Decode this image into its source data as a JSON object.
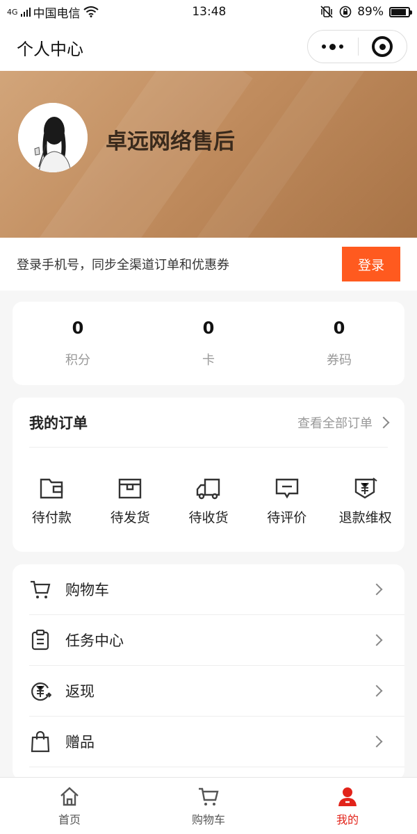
{
  "status_bar": {
    "network": "4G",
    "carrier": "中国电信",
    "time": "13:48",
    "battery": "89%",
    "battery_level": 0.89
  },
  "nav": {
    "title": "个人中心"
  },
  "banner": {
    "shop_name": "卓远网络售后"
  },
  "login_bar": {
    "tip": "登录手机号，同步全渠道订单和优惠券",
    "button": "登录",
    "button_color": "#ff5a1f"
  },
  "stats": [
    {
      "value": "0",
      "label": "积分"
    },
    {
      "value": "0",
      "label": "卡"
    },
    {
      "value": "0",
      "label": "券码"
    }
  ],
  "orders": {
    "title": "我的订单",
    "view_all": "查看全部订单",
    "items": [
      {
        "label": "待付款",
        "icon": "wallet-icon"
      },
      {
        "label": "待发货",
        "icon": "package-icon"
      },
      {
        "label": "待收货",
        "icon": "truck-icon"
      },
      {
        "label": "待评价",
        "icon": "comment-icon"
      },
      {
        "label": "退款维权",
        "icon": "refund-icon"
      }
    ]
  },
  "menu": [
    {
      "label": "购物车",
      "icon": "cart-icon"
    },
    {
      "label": "任务中心",
      "icon": "clipboard-icon"
    },
    {
      "label": "返现",
      "icon": "cashback-icon"
    },
    {
      "label": "赠品",
      "icon": "gift-bag-icon"
    }
  ],
  "tabbar": [
    {
      "label": "首页",
      "icon": "home-icon"
    },
    {
      "label": "购物车",
      "icon": "cart-icon"
    },
    {
      "label": "我的",
      "icon": "user-icon",
      "active": true
    }
  ],
  "colors": {
    "accent": "#e2231a",
    "banner": "#c18d5f"
  }
}
